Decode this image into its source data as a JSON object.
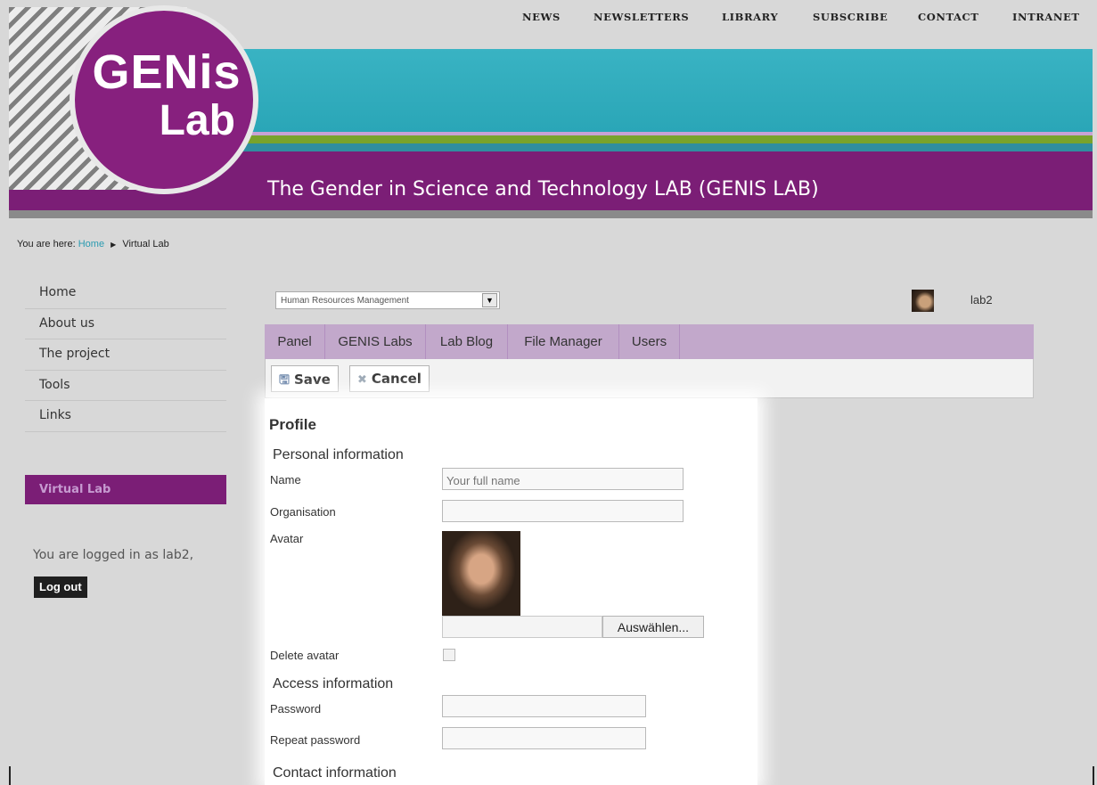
{
  "top_nav": [
    "NEWS",
    "NEWSLETTERS",
    "LIBRARY",
    "SUBSCRIBE",
    "CONTACT",
    "INTRANET"
  ],
  "logo": {
    "line1": "GENis",
    "line2": "Lab"
  },
  "banner_title": "The Gender in Science and Technology LAB (GENIS LAB)",
  "breadcrumb": {
    "prefix": "You are here:",
    "home": "Home",
    "current": "Virtual Lab"
  },
  "sidebar": {
    "items": [
      "Home",
      "About us",
      "The project",
      "Tools",
      "Links"
    ],
    "section_title": "Virtual Lab",
    "logged_in_text": "You are logged in as lab2,",
    "logout_label": "Log out"
  },
  "lab_select": {
    "selected": "Human Resources Management"
  },
  "user": {
    "name": "lab2"
  },
  "tabs": [
    "Panel",
    "GENIS Labs",
    "Lab Blog",
    "File Manager",
    "Users"
  ],
  "toolbar": {
    "save_label": "Save",
    "cancel_label": "Cancel"
  },
  "form": {
    "title": "Profile",
    "personal_section": "Personal information",
    "name_label": "Name",
    "name_placeholder": "Your full name",
    "organisation_label": "Organisation",
    "avatar_label": "Avatar",
    "file_button_label": "Auswählen...",
    "delete_avatar_label": "Delete avatar",
    "access_section": "Access information",
    "password_label": "Password",
    "repeat_password_label": "Repeat password",
    "contact_section": "Contact information"
  },
  "colors": {
    "purple": "#7b1e76",
    "teal": "#2aa6b7",
    "tab_bar": "#c2a8cb",
    "link": "#2a9bb1"
  }
}
